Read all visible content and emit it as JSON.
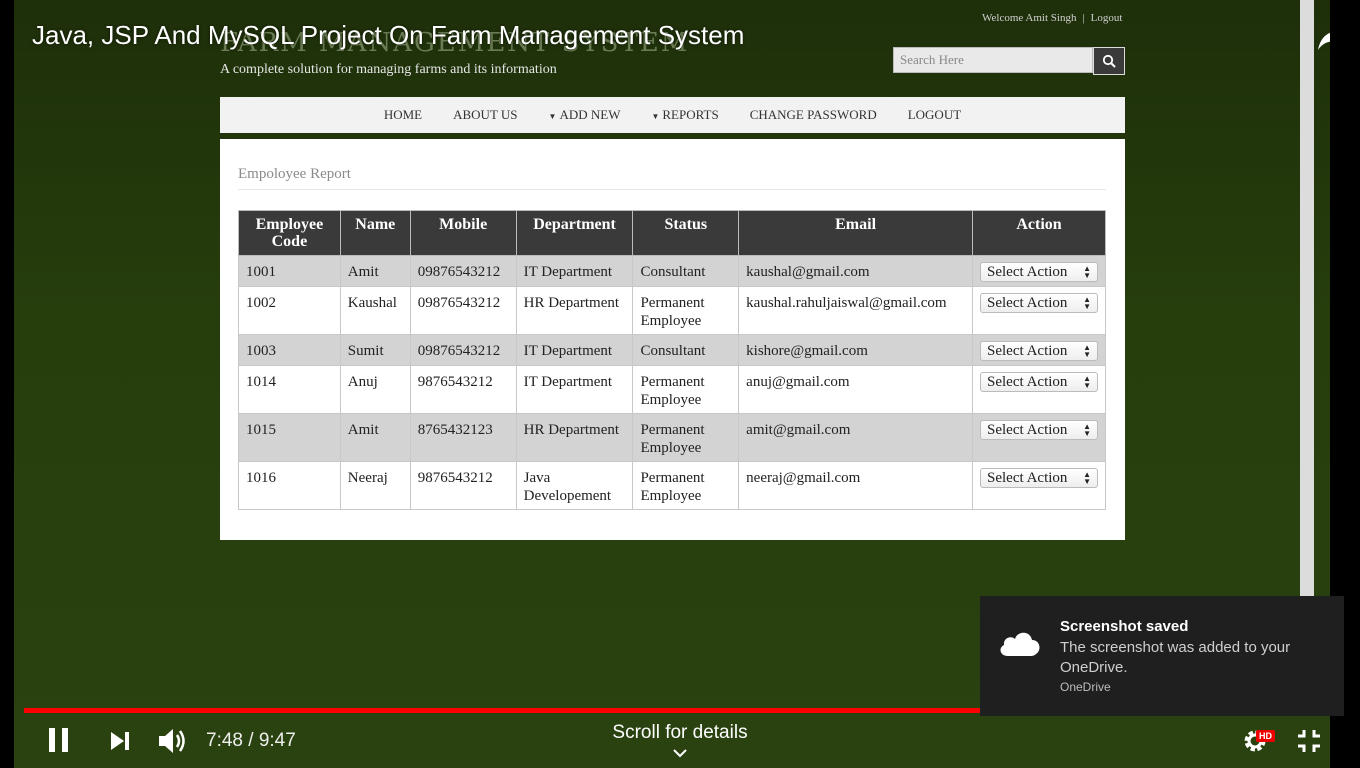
{
  "video": {
    "title": "Java, JSP And MySQL Project On Farm Management System",
    "time": "7:48 / 9:47",
    "progress": 0.797,
    "scroll_hint": "Scroll for details",
    "hd_badge": "HD"
  },
  "site": {
    "title": "Farm Management System",
    "tagline": "A complete solution for managing farms and its information",
    "welcome": "Welcome Amit Singh",
    "logout_link": "Logout",
    "search_placeholder": "Search Here"
  },
  "nav": {
    "items": [
      "HOME",
      "ABOUT US",
      "ADD NEW",
      "REPORTS",
      "CHANGE PASSWORD",
      "LOGOUT"
    ]
  },
  "report": {
    "title": "Empoloyee Report",
    "columns": [
      "Employee Code",
      "Name",
      "Mobile",
      "Department",
      "Status",
      "Email",
      "Action"
    ],
    "select_label": "Select Action",
    "rows": [
      {
        "code": "1001",
        "name": "Amit",
        "mobile": "09876543212",
        "department": "IT Department",
        "status": "Consultant",
        "email": "kaushal@gmail.com"
      },
      {
        "code": "1002",
        "name": "Kaushal",
        "mobile": "09876543212",
        "department": "HR Department",
        "status": "Permanent Employee",
        "email": "kaushal.rahuljaiswal@gmail.com"
      },
      {
        "code": "1003",
        "name": "Sumit",
        "mobile": "09876543212",
        "department": "IT Department",
        "status": "Consultant",
        "email": "kishore@gmail.com"
      },
      {
        "code": "1014",
        "name": "Anuj",
        "mobile": "9876543212",
        "department": "IT Department",
        "status": "Permanent Employee",
        "email": "anuj@gmail.com"
      },
      {
        "code": "1015",
        "name": "Amit",
        "mobile": "8765432123",
        "department": "HR Department",
        "status": "Permanent Employee",
        "email": "amit@gmail.com"
      },
      {
        "code": "1016",
        "name": "Neeraj",
        "mobile": "9876543212",
        "department": "Java Developement",
        "status": "Permanent Employee",
        "email": "neeraj@gmail.com"
      }
    ]
  },
  "toast": {
    "heading": "Screenshot saved",
    "body": "The screenshot was added to your OneDrive.",
    "source": "OneDrive"
  },
  "colors": {
    "video_bg": "#263d0c",
    "table_header": "#3a3a3a",
    "progress": "#ff0000",
    "toast_bg": "#1f1f1f"
  }
}
